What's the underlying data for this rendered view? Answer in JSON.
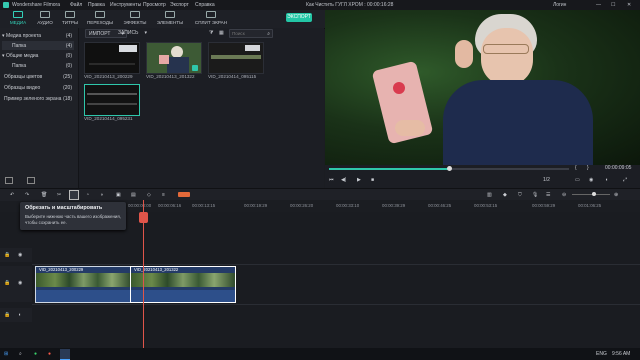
{
  "app": {
    "name": "Wondershare Filmora",
    "menu": [
      "Файл",
      "Правка",
      "Инструменты",
      "Просмотр",
      "Экспорт",
      "Справка"
    ],
    "project_title": "Как Чистить ГУГЛ ХРОМ : 00:00:16:28",
    "login": "Логин"
  },
  "topnav": {
    "tabs": [
      {
        "label": "МЕДИА",
        "active": true
      },
      {
        "label": "АУДИО",
        "active": false
      },
      {
        "label": "ТИТРЫ",
        "active": false
      },
      {
        "label": "ПЕРЕХОДЫ",
        "active": false
      },
      {
        "label": "ЭФФЕКТЫ",
        "active": false
      },
      {
        "label": "ЭЛЕМЕНТЫ",
        "active": false
      },
      {
        "label": "СПЛИТ ЭКРАН",
        "active": false
      }
    ],
    "export_label": "ЭКСПОРТ"
  },
  "sidebar": {
    "items": [
      {
        "label": "Медиа проекта",
        "count": "(4)",
        "selected": false
      },
      {
        "label": "Папка",
        "count": "(4)",
        "selected": true
      },
      {
        "label": "Общие медиа",
        "count": "(0)",
        "selected": false
      },
      {
        "label": "Папка",
        "count": "(0)",
        "selected": false
      },
      {
        "label": "Образцы цветов",
        "count": "(25)",
        "selected": false
      },
      {
        "label": "Образцы видео",
        "count": "(20)",
        "selected": false
      },
      {
        "label": "Пример зеленого экрана",
        "count": "(18)",
        "selected": false
      }
    ]
  },
  "media": {
    "import_label": "ИМПОРТ",
    "record_label": "ЗАПИСЬ",
    "search_placeholder": "Поиск",
    "thumbs": [
      {
        "caption": "VID_20210413_200229"
      },
      {
        "caption": "VID_20210413_201322"
      },
      {
        "caption": "VID_20210414_095115"
      },
      {
        "caption": "VID_20210414_095231"
      }
    ]
  },
  "preview": {
    "page": "1/2",
    "timecode": "00:00:09:05"
  },
  "timeline": {
    "ticks": [
      "00:00:00:00",
      "00:00:06:16",
      "00:00:13:15",
      "00:00:19:29",
      "00:00:26:20",
      "00:00:33:10",
      "00:00:39:29",
      "00:00:46:25",
      "00:00:53:15",
      "00:00:59:29",
      "00:01:06:25"
    ],
    "tooltip_title": "Обрезать и масштабировать",
    "tooltip_body": "Выберите нижнюю часть вашего изображения, чтобы сохранить ее.",
    "clips": [
      {
        "caption": "VID_20210413_200229"
      },
      {
        "caption": "VID_20210413_201322"
      }
    ]
  },
  "taskbar": {
    "lang": "ENG",
    "time": "9:56 AM"
  }
}
